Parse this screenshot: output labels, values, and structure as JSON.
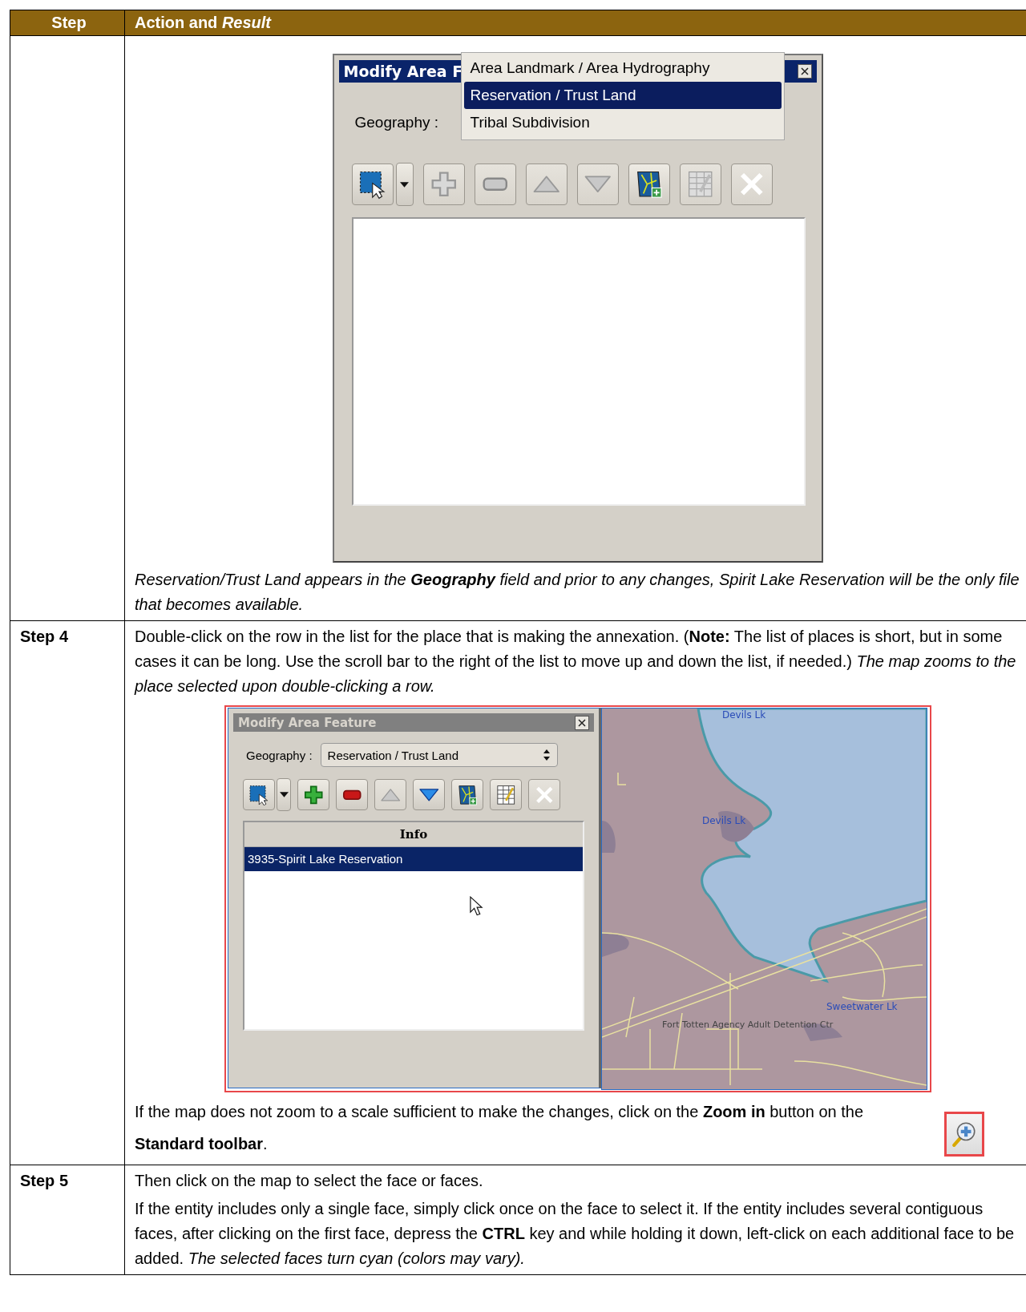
{
  "table": {
    "columns": [
      "Step",
      "Action and *Result*"
    ],
    "rows": [
      {
        "blocks": [
          {
            "kind": "dialog",
            "active": true,
            "title": "Modify Area F",
            "geography_label": "Geography :",
            "dropdown": [
              {
                "label": "Area Landmark / Area Hydrography",
                "selected": false
              },
              {
                "label": "Reservation / Trust Land",
                "selected": true
              },
              {
                "label": "Tribal Subdivision",
                "selected": false
              }
            ],
            "tools": [
              {
                "kind": "select"
              },
              {
                "kind": "add",
                "disabled": true
              },
              {
                "kind": "remove",
                "disabled": true
              },
              {
                "kind": "up",
                "disabled": true
              },
              {
                "kind": "down",
                "disabled": true
              },
              {
                "kind": "map",
                "disabled": false
              },
              {
                "kind": "table",
                "disabled": true
              },
              {
                "kind": "delete",
                "disabled": true
              }
            ]
          },
          {
            "kind": "para",
            "italic": true,
            "text": "Reservation/Trust Land appears in the **Geography** field and prior to any changes, Spirit Lake Reservation will be the only file that becomes available."
          }
        ]
      },
      {
        "step": "Step 4",
        "blocks": [
          {
            "kind": "para",
            "italic": false,
            "text": "Double-click on the row in the list for the place that is making the annexation. (**Note:**  The list of places is short, but in some cases it can be long. Use the scroll bar to the right of the list to move up and down the list, if needed.) *The map zooms to the place selected upon double-clicking a row.*"
          },
          {
            "kind": "dialog",
            "active": false,
            "title": "Modify Area Feature",
            "geography_label": "Geography :",
            "geography_value": "Reservation / Trust Land",
            "tools": [
              {
                "kind": "select"
              },
              {
                "kind": "add",
                "disabled": false
              },
              {
                "kind": "remove",
                "disabled": false
              },
              {
                "kind": "up",
                "disabled": true
              },
              {
                "kind": "down",
                "disabled": false
              },
              {
                "kind": "map",
                "disabled": false
              },
              {
                "kind": "table",
                "disabled": false
              },
              {
                "kind": "delete",
                "disabled": true
              }
            ],
            "list_header": "Info",
            "list_rows": [
              {
                "label": "3935-Spirit Lake Reservation",
                "selected": true
              }
            ],
            "map": {
              "labels": [
                "Devils Lk",
                "Devils Lk",
                "Sweetwater Lk",
                "Fort Totten Agency Adult Detention Ctr"
              ]
            }
          },
          {
            "kind": "para_zoom",
            "italic": false,
            "text": "If the map does not zoom to a scale sufficient to make the changes, click on the **Zoom in** button on the **Standard toolbar**."
          }
        ]
      },
      {
        "step": "Step 5",
        "blocks": [
          {
            "kind": "para",
            "italic": false,
            "text": "Then click on the map to select the face or faces."
          },
          {
            "kind": "para",
            "italic": false,
            "text": "If the entity includes only a single face, simply click once on the face to select it. If the entity includes several contiguous faces, after clicking on the first face, depress the **CTRL** key and while holding it down, left-click on each additional face to be added. *The selected faces turn cyan (colors may vary).*"
          }
        ]
      }
    ]
  }
}
